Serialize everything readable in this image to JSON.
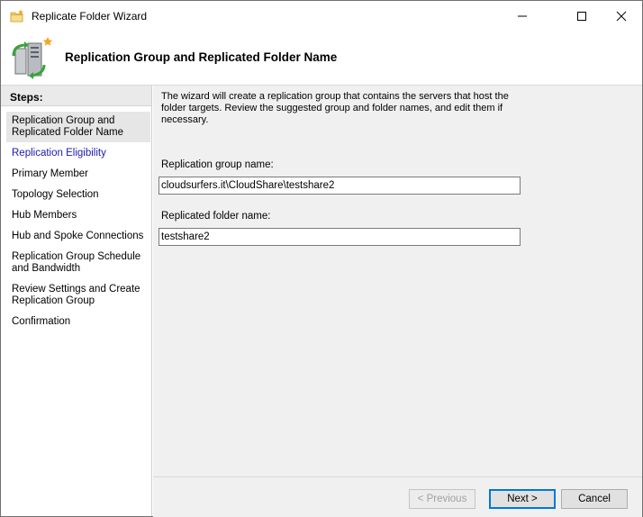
{
  "window": {
    "title": "Replicate Folder Wizard"
  },
  "titlebar": {
    "min_icon": "minimize-icon",
    "max_icon": "maximize-icon",
    "close_icon": "close-icon"
  },
  "header": {
    "title": "Replication Group and Replicated Folder Name",
    "icon": "replication-wizard-icon"
  },
  "steps": {
    "heading": "Steps:",
    "items": [
      {
        "label_line1": "Replication Group and",
        "label_line2": "Replicated Folder Name",
        "state": "current"
      },
      {
        "label_line1": "Replication Eligibility",
        "state": "link"
      },
      {
        "label_line1": "Primary Member",
        "state": "normal"
      },
      {
        "label_line1": "Topology Selection",
        "state": "normal"
      },
      {
        "label_line1": "Hub Members",
        "state": "normal"
      },
      {
        "label_line1": "Hub and Spoke Connections",
        "state": "normal"
      },
      {
        "label_line1": "Replication Group Schedule",
        "label_line2": "and Bandwidth",
        "state": "normal"
      },
      {
        "label_line1": "Review Settings and Create",
        "label_line2": "Replication Group",
        "state": "normal"
      },
      {
        "label_line1": "Confirmation",
        "state": "normal"
      }
    ]
  },
  "content": {
    "intro_line1": "The wizard will create a replication group that contains the servers that host the",
    "intro_line2": "folder targets. Review the suggested group and folder names, and edit them if",
    "intro_line3": "necessary.",
    "group_label": "Replication group name:",
    "group_value": "cloudsurfers.it\\CloudShare\\testshare2",
    "folder_label": "Replicated folder name:",
    "folder_value": "testshare2"
  },
  "footer": {
    "prev": "< Previous",
    "next": "Next >",
    "cancel": "Cancel"
  }
}
